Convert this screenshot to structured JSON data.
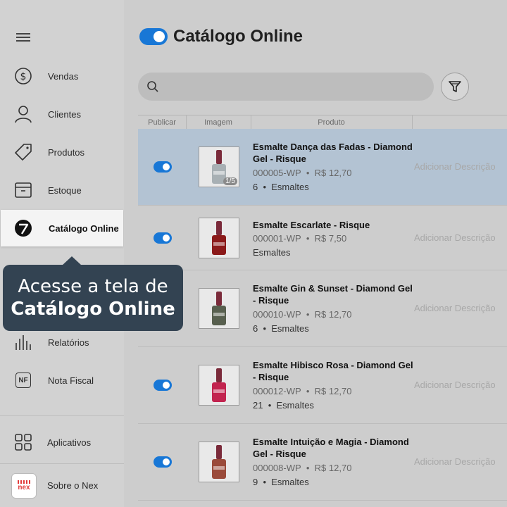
{
  "sidebar": {
    "items": [
      {
        "label": "Vendas",
        "icon": "dollar-circle-icon"
      },
      {
        "label": "Clientes",
        "icon": "user-icon"
      },
      {
        "label": "Produtos",
        "icon": "tag-icon"
      },
      {
        "label": "Estoque",
        "icon": "box-icon"
      },
      {
        "label": "Catálogo Online",
        "icon": "catalog-icon"
      },
      {
        "label": "Relatórios",
        "icon": "bar-chart-icon"
      },
      {
        "label": "Nota Fiscal",
        "icon": "nf-icon"
      },
      {
        "label": "Aplicativos",
        "icon": "grid-icon"
      },
      {
        "label": "Sobre o Nex",
        "icon": "nex-logo-icon"
      }
    ],
    "nf_badge": "NF",
    "nex_logo_text": "nex"
  },
  "tooltip": {
    "line1": "Acesse a tela de",
    "line2": "Catálogo Online",
    "bg": "#334352"
  },
  "header": {
    "title": "Catálogo Online",
    "accent": "#1877d6"
  },
  "search": {
    "placeholder": ""
  },
  "table": {
    "columns": [
      "Publicar",
      "Imagem",
      "Produto"
    ],
    "rows": [
      {
        "name": "Esmalte Dança das Fadas - Diamond Gel - Risque",
        "code": "000005-WP",
        "price": "R$ 12,70",
        "stock": "6",
        "category": "Esmaltes",
        "description": "Adicionar Descrição",
        "image_count": "1/5",
        "polish_color": "#a8b0b4",
        "selected": true
      },
      {
        "name": "Esmalte Escarlate - Risque",
        "code": "000001-WP",
        "price": "R$ 7,50",
        "stock": "",
        "category": "Esmaltes",
        "description": "Adicionar Descrição",
        "image_count": "",
        "polish_color": "#8b1a1a",
        "selected": false
      },
      {
        "name": "Esmalte Gin & Sunset - Diamond Gel - Risque",
        "code": "000010-WP",
        "price": "R$ 12,70",
        "stock": "6",
        "category": "Esmaltes",
        "description": "Adicionar Descrição",
        "image_count": "",
        "polish_color": "#58604f",
        "selected": false
      },
      {
        "name": "Esmalte Hibisco Rosa - Diamond Gel - Risque",
        "code": "000012-WP",
        "price": "R$ 12,70",
        "stock": "21",
        "category": "Esmaltes",
        "description": "Adicionar Descrição",
        "image_count": "",
        "polish_color": "#c2244f",
        "selected": false
      },
      {
        "name": "Esmalte Intuição e Magia - Diamond Gel - Risque",
        "code": "000008-WP",
        "price": "R$ 12,70",
        "stock": "9",
        "category": "Esmaltes",
        "description": "Adicionar Descrição",
        "image_count": "",
        "polish_color": "#9a4a3a",
        "selected": false
      }
    ]
  }
}
